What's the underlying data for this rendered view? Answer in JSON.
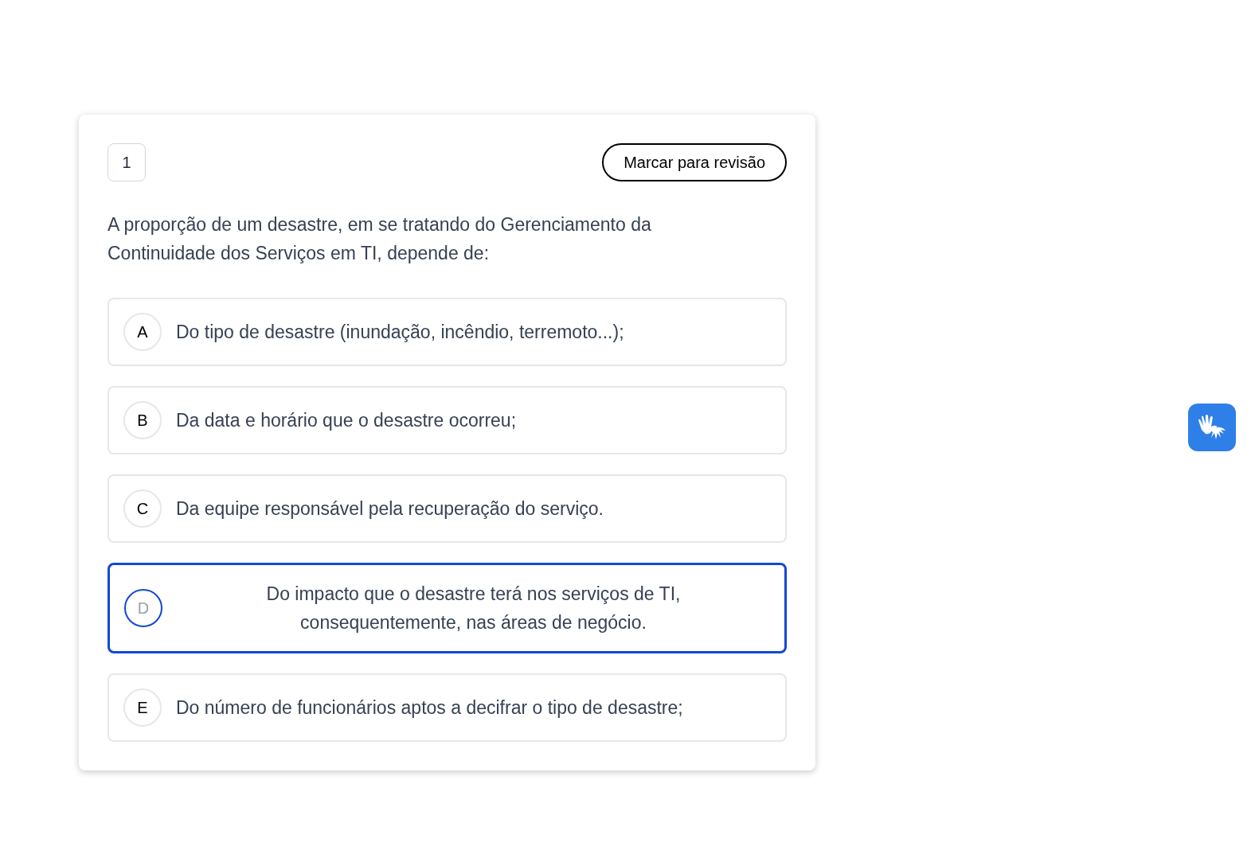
{
  "question": {
    "number": "1",
    "review_button": "Marcar para revisão",
    "text": "A proporção de um desastre, em se tratando do Gerenciamento da Continuidade dos Serviços em TI, depende de:"
  },
  "options": [
    {
      "letter": "A",
      "text": "Do tipo de desastre (inundação, incêndio, terremoto...);",
      "selected": false
    },
    {
      "letter": "B",
      "text": "Da data e horário que o desastre ocorreu;",
      "selected": false
    },
    {
      "letter": "C",
      "text": "Da equipe responsável pela recuperação do serviço.",
      "selected": false
    },
    {
      "letter": "D",
      "text": "Do impacto que o desastre terá nos serviços de TI, consequentemente, nas áreas de negócio.",
      "selected": true
    },
    {
      "letter": "E",
      "text": "Do número de funcionários aptos a decifrar o tipo de desastre;",
      "selected": false
    }
  ]
}
